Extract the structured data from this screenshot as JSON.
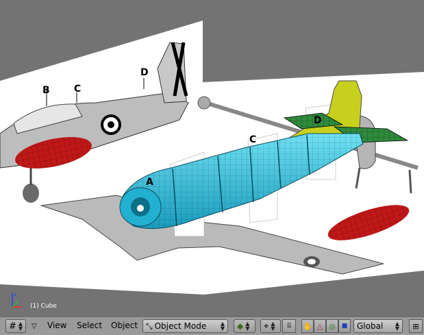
{
  "viewport": {
    "object_label": "(1) Cube",
    "reference_letters": [
      "A",
      "B",
      "C",
      "D"
    ]
  },
  "header": {
    "menus": [
      "View",
      "Select",
      "Object"
    ],
    "mode": "Object Mode",
    "orientation": "Global"
  },
  "colors": {
    "background": "#737373",
    "fuselage": "#29b8d6",
    "tail": "#c8d01e",
    "wing": "#2f8a3c",
    "fuel_tank": "#c01818"
  }
}
